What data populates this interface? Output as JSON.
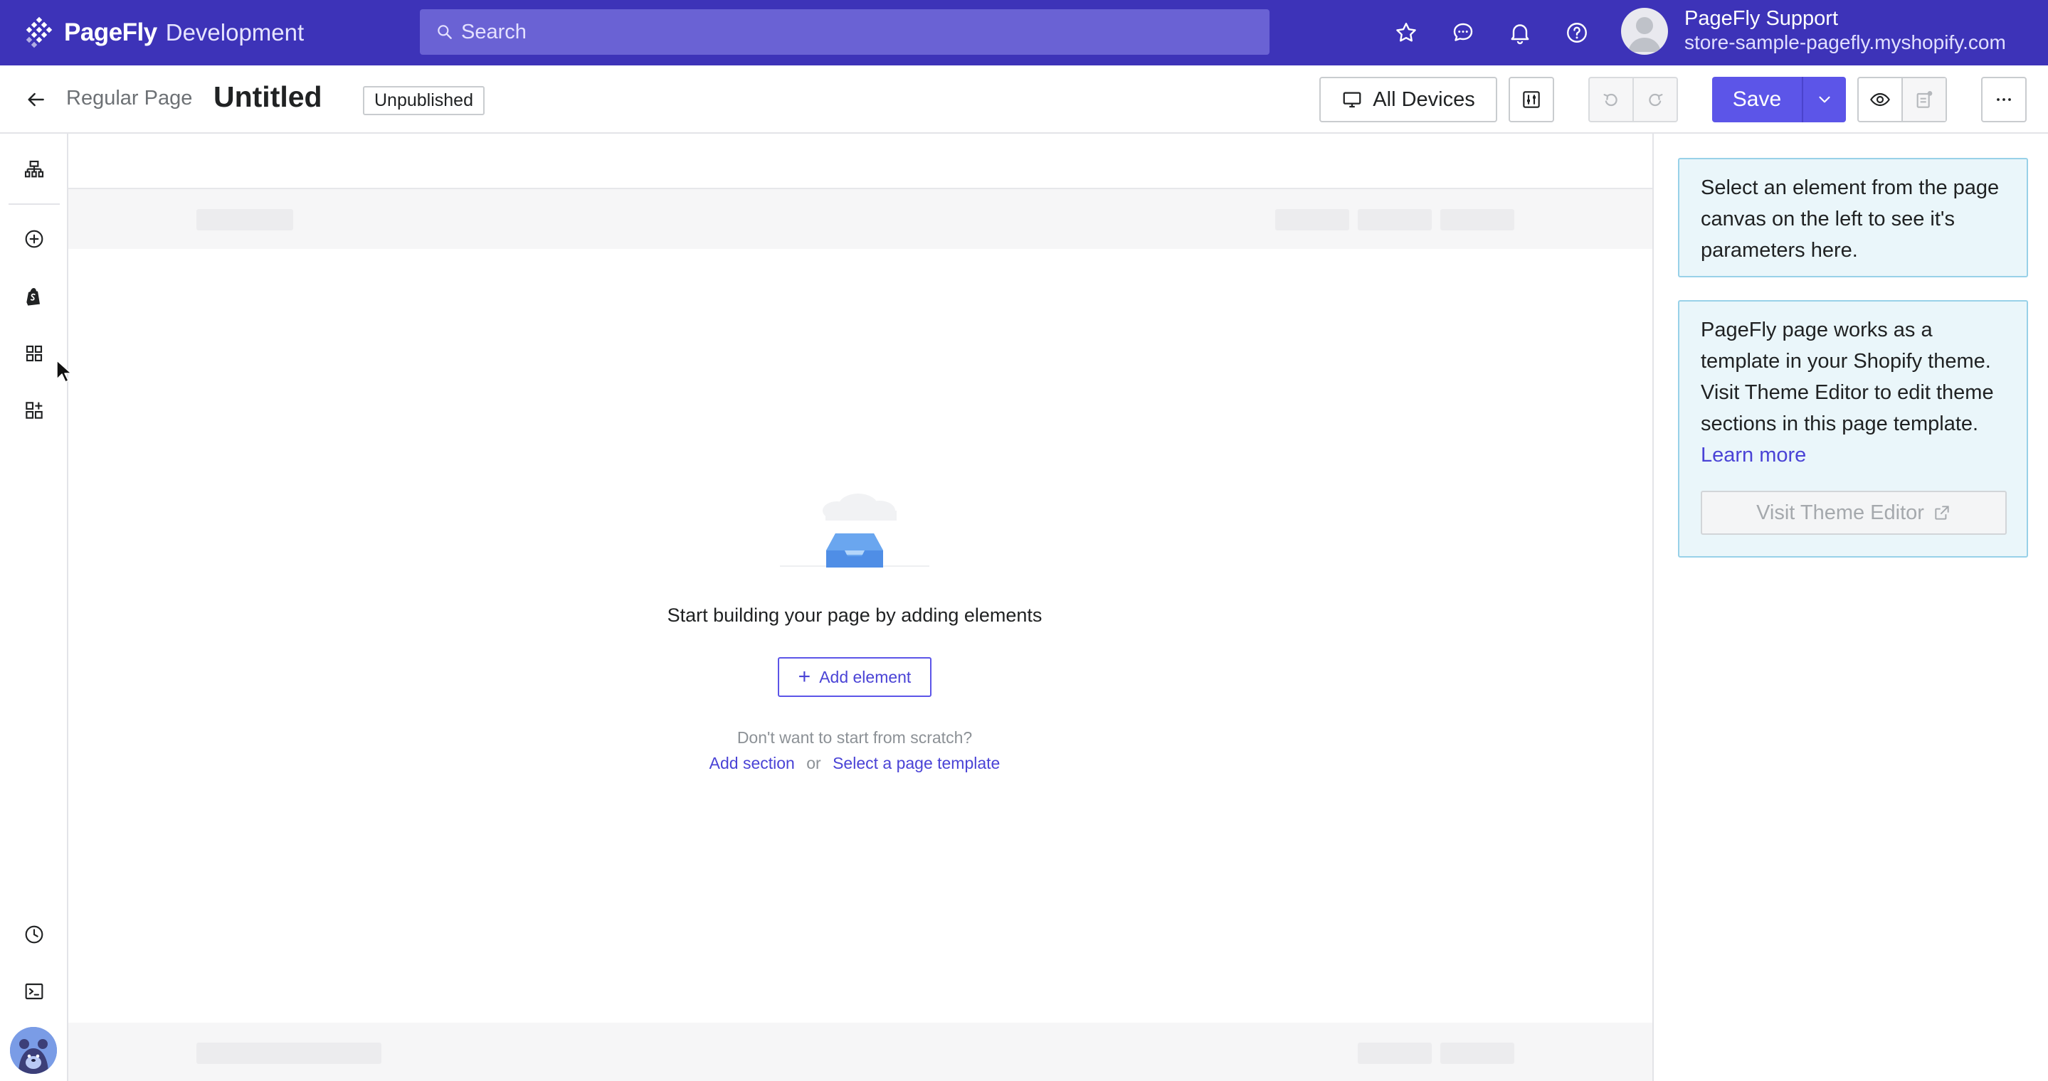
{
  "topbar": {
    "brand_name": "PageFly",
    "brand_env": "Development",
    "search_placeholder": "Search",
    "user_name": "PageFly Support",
    "user_store": "store-sample-pagefly.myshopify.com",
    "icons": [
      "star-icon",
      "chat-icon",
      "bell-icon",
      "help-icon"
    ]
  },
  "toolbar": {
    "page_type": "Regular Page",
    "page_title": "Untitled",
    "status": "Unpublished",
    "devices_label": "All Devices",
    "save_label": "Save"
  },
  "rail": {
    "icons": [
      "page-outline-icon",
      "add-circle-icon",
      "shopify-bag-icon",
      "grid-icon",
      "add-widget-icon",
      "history-icon",
      "terminal-icon"
    ]
  },
  "canvas": {
    "empty_title": "Start building your page by adding elements",
    "add_element_label": "Add element",
    "scratch_text": "Don't want to start from scratch?",
    "add_section_label": "Add section",
    "or_text": "or",
    "select_template_label": "Select a page template"
  },
  "panel": {
    "info1_text": "Select an element from the page canvas on the left to see it's parameters here.",
    "info2_text": "PageFly page works as a template in your Shopify theme. Visit Theme Editor to edit theme sections in this page template.",
    "learn_more_label": "Learn more",
    "visit_theme_label": "Visit Theme Editor"
  },
  "colors": {
    "brand": "#3d33b8",
    "accent": "#5c55e8",
    "link": "#4a43d6",
    "info_bg": "#eaf6fa",
    "info_border": "#98d1e8"
  }
}
